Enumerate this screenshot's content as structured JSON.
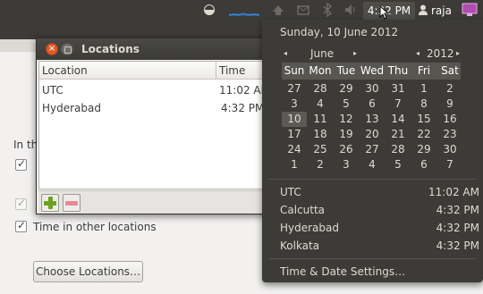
{
  "panel": {
    "clock": "4:32 PM",
    "user": "raja"
  },
  "background_window": {
    "label_partial": "In th",
    "choose_button": "Choose Locations…",
    "time_other_locations": "Time in other locations"
  },
  "locations_dialog": {
    "title": "Locations",
    "columns": [
      "Location",
      "Time"
    ],
    "rows": [
      {
        "location": "UTC",
        "time": "11:02 AM"
      },
      {
        "location": "Hyderabad",
        "time": "4:32 PM"
      }
    ]
  },
  "calendar": {
    "date_heading": "Sunday, 10 June 2012",
    "month": "June",
    "year": "2012",
    "weekdays": [
      "Sun",
      "Mon",
      "Tue",
      "Wed",
      "Thu",
      "Fri",
      "Sat"
    ],
    "weeks": [
      [
        "27",
        "28",
        "29",
        "30",
        "31",
        "1",
        "2"
      ],
      [
        "3",
        "4",
        "5",
        "6",
        "7",
        "8",
        "9"
      ],
      [
        "10",
        "11",
        "12",
        "13",
        "14",
        "15",
        "16"
      ],
      [
        "17",
        "18",
        "19",
        "20",
        "21",
        "22",
        "23"
      ],
      [
        "24",
        "25",
        "26",
        "27",
        "28",
        "29",
        "30"
      ],
      [
        "1",
        "2",
        "3",
        "4",
        "5",
        "6",
        "7"
      ]
    ],
    "selected_day": "10"
  },
  "world_clock": [
    {
      "name": "UTC",
      "time": "11:02 AM"
    },
    {
      "name": "Calcutta",
      "time": "4:32 PM"
    },
    {
      "name": "Hyderabad",
      "time": "4:32 PM"
    },
    {
      "name": "Kolkata",
      "time": "4:32 PM"
    }
  ],
  "settings_label": "Time & Date Settings…",
  "colors": {
    "panel": "#3c3b37",
    "menu": "#3c3b37",
    "close_button": "#e05a2b",
    "add_button": "#6aa121",
    "remove_button": "#e58a96"
  },
  "icons": {
    "close": "close-icon",
    "minimize": "minimize-icon",
    "add": "add-icon",
    "remove": "remove-icon",
    "user": "user-icon",
    "session": "session-icon"
  }
}
